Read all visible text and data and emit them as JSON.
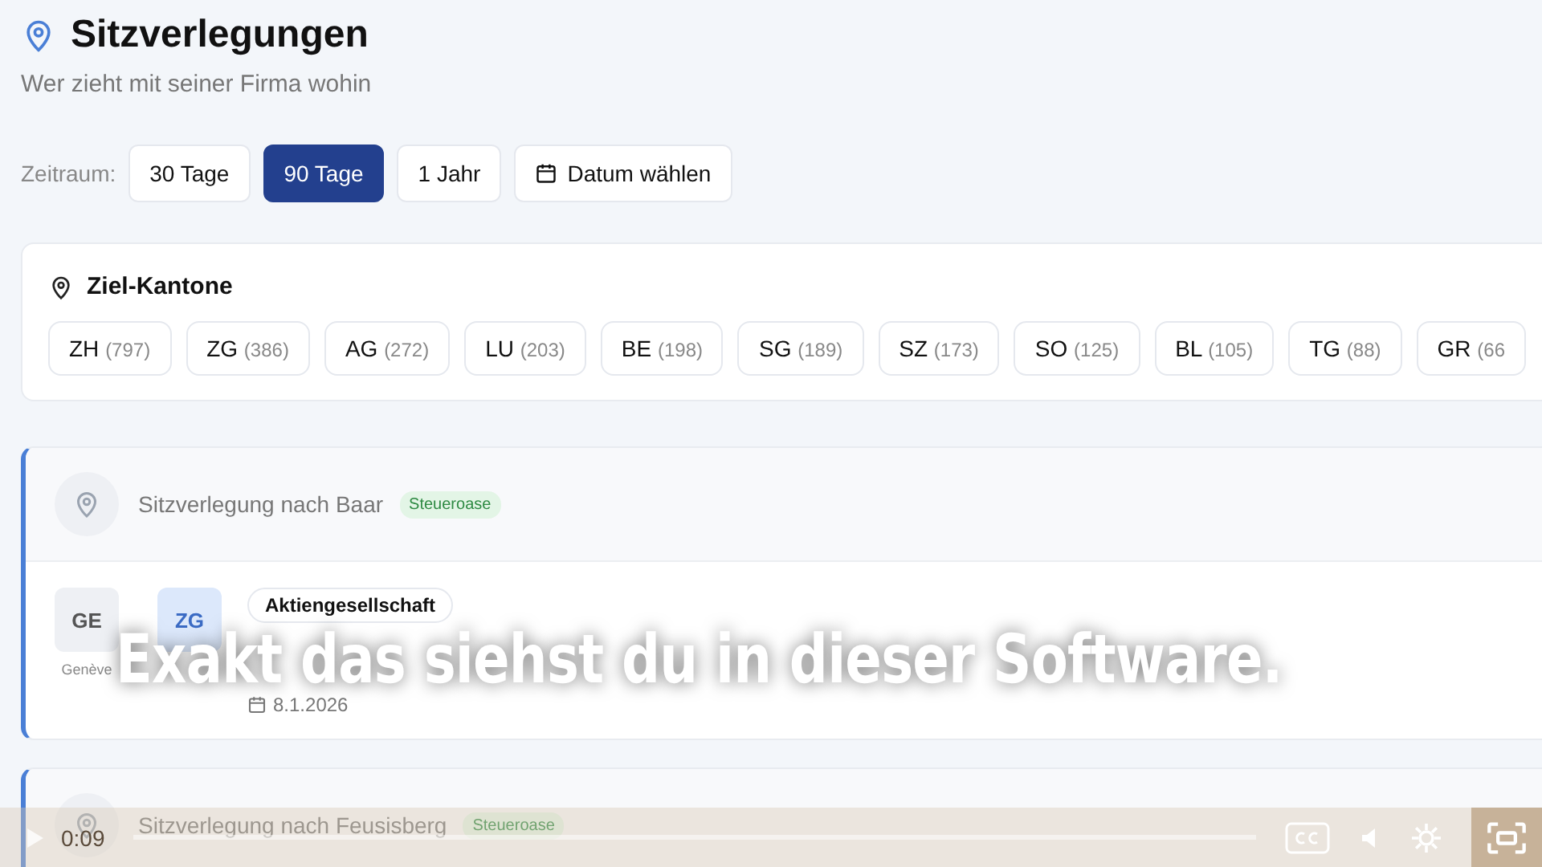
{
  "header": {
    "title": "Sitzverlegungen",
    "subtitle": "Wer zieht mit seiner Firma wohin"
  },
  "period": {
    "label": "Zeitraum:",
    "options": [
      {
        "label": "30 Tage",
        "selected": false,
        "kind": "plain"
      },
      {
        "label": "90 Tage",
        "selected": true,
        "kind": "plain"
      },
      {
        "label": "1 Jahr",
        "selected": false,
        "kind": "plain"
      },
      {
        "label": "Datum wählen",
        "selected": false,
        "kind": "date"
      }
    ]
  },
  "cantons": {
    "title": "Ziel-Kantone",
    "items": [
      {
        "code": "ZH",
        "count": "(797)"
      },
      {
        "code": "ZG",
        "count": "(386)"
      },
      {
        "code": "AG",
        "count": "(272)"
      },
      {
        "code": "LU",
        "count": "(203)"
      },
      {
        "code": "BE",
        "count": "(198)"
      },
      {
        "code": "SG",
        "count": "(189)"
      },
      {
        "code": "SZ",
        "count": "(173)"
      },
      {
        "code": "SO",
        "count": "(125)"
      },
      {
        "code": "BL",
        "count": "(105)"
      },
      {
        "code": "TG",
        "count": "(88)"
      },
      {
        "code": "GR",
        "count": "(66"
      }
    ]
  },
  "relocations": [
    {
      "title": "Sitzverlegung nach Baar",
      "tag": "Steueroase",
      "from": {
        "code": "GE",
        "city": "Genève"
      },
      "to": {
        "code": "ZG"
      },
      "legal_form": "Aktiengesellschaft",
      "date": "8.1.2026"
    },
    {
      "title": "Sitzverlegung nach Feusisberg",
      "tag": "Steueroase"
    }
  ],
  "subtitle_caption": "Exakt das siehst du in dieser Software.",
  "player": {
    "time": "0:09"
  }
}
